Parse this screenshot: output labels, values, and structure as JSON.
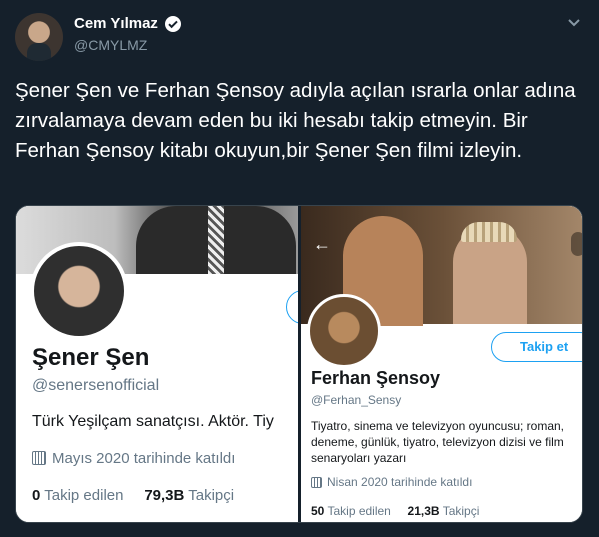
{
  "tweet": {
    "author_name": "Cem Yılmaz",
    "author_handle": "@CMYLMZ",
    "text": "Şener Şen ve Ferhan Şensoy adıyla açılan ısrarla onlar adına zırvalamaya devam eden bu iki hesabı takip etmeyin. Bir Ferhan Şensoy kitabı okuyun,bir Şener Şen filmi izleyin."
  },
  "card_left": {
    "name": "Şener Şen",
    "handle": "@senersenofficial",
    "bio": "Türk Yeşilçam sanatçısı. Aktör. Tiy",
    "joined": "Mayıs 2020 tarihinde katıldı",
    "following_count": "0",
    "following_label": "Takip edilen",
    "followers_count": "79,3B",
    "followers_label": "Takipçi"
  },
  "card_right": {
    "name": "Ferhan Şensoy",
    "handle": "@Ferhan_Sensy",
    "follow_button": "Takip et",
    "bio": "Tiyatro, sinema ve televizyon oyuncusu; roman, deneme, günlük, tiyatro, televizyon dizisi ve film senaryoları yazarı",
    "joined": "Nisan 2020 tarihinde katıldı",
    "following_count": "50",
    "following_label": "Takip edilen",
    "followers_count": "21,3B",
    "followers_label": "Takipçi"
  },
  "colors": {
    "background": "#15202b",
    "accent": "#1da1f2",
    "secondary_text": "#8899a6"
  },
  "icons": {
    "verified": "verified-badge-icon",
    "more": "chevron-down-icon",
    "back": "arrow-left-icon",
    "calendar": "calendar-icon"
  }
}
